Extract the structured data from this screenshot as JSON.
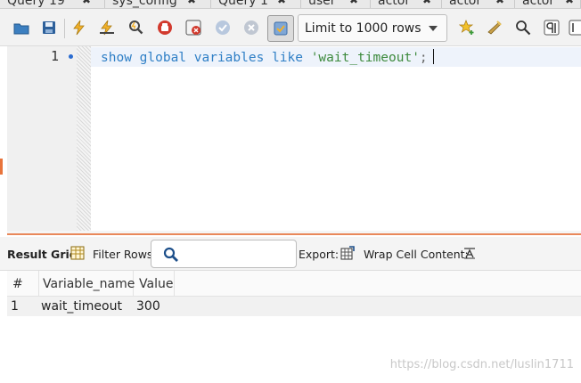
{
  "tabs": [
    {
      "label": "Query 19"
    },
    {
      "label": "sys_config"
    },
    {
      "label": "Query 1"
    },
    {
      "label": "user"
    },
    {
      "label": "actor"
    },
    {
      "label": "actor"
    },
    {
      "label": "actor"
    }
  ],
  "toolbar": {
    "limit_label": "Limit to 1000 rows",
    "icons": [
      "open-folder-icon",
      "save-icon",
      "execute-icon",
      "execute-current-icon",
      "explain-icon",
      "stop-icon",
      "toggle-error-icon",
      "commit-icon",
      "rollback-icon",
      "autocommit-icon",
      "bookmark-star-icon",
      "beautify-icon",
      "find-icon",
      "invisible-chars-icon",
      "wrap-icon"
    ]
  },
  "editor": {
    "line_number": "1",
    "code_keywords": "show global variables like ",
    "code_string": "'wait_timeout'",
    "code_end": ";"
  },
  "result": {
    "grid_label": "Result Grid",
    "filter_label": "Filter Rows:",
    "export_label": "Export:",
    "wrap_label": "Wrap Cell Content:",
    "columns": [
      "#",
      "Variable_name",
      "Value"
    ],
    "rows": [
      {
        "index": "1",
        "variable_name": "wait_timeout",
        "value": "300"
      }
    ]
  },
  "watermark": "https://blog.csdn.net/luslin1711",
  "colors": {
    "accent_orange": "#e9885a",
    "keyword_blue": "#2f7fc6",
    "string_green": "#3d8a3d"
  }
}
